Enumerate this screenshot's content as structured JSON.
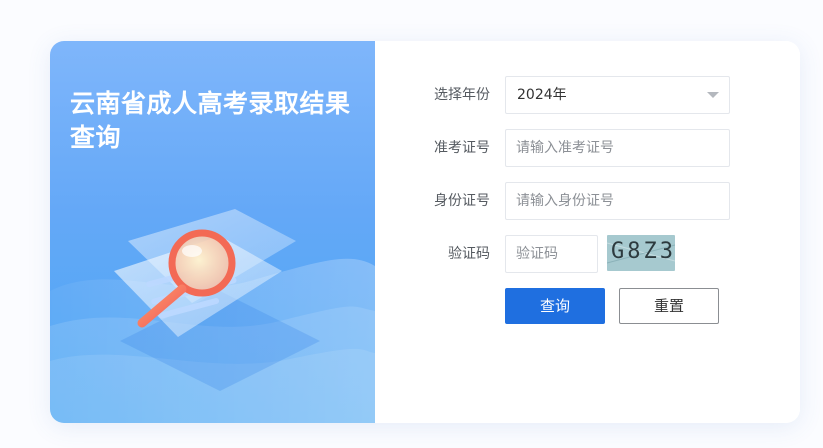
{
  "title": "云南省成人高考录取结果查询",
  "form": {
    "year": {
      "label": "选择年份",
      "value": "2024年"
    },
    "exam_no": {
      "label": "准考证号",
      "placeholder": "请输入准考证号"
    },
    "id_no": {
      "label": "身份证号",
      "placeholder": "请输入身份证号"
    },
    "captcha": {
      "label": "验证码",
      "placeholder": "验证码",
      "image_text": "G8Z3"
    }
  },
  "buttons": {
    "query": "查询",
    "reset": "重置"
  },
  "colors": {
    "accent": "#1f6fe0",
    "panel_gradient_top": "#7fb6fb",
    "panel_gradient_bottom": "#4aa6f3"
  }
}
